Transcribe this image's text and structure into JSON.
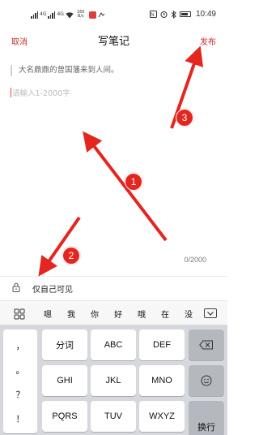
{
  "status_bar": {
    "net_label_1": "4G",
    "net_label_2": "4G",
    "speed_top": "160",
    "speed_bottom": "B/s",
    "time": "10:49"
  },
  "header": {
    "cancel_label": "取消",
    "title": "写笔记",
    "publish_label": "发布"
  },
  "editor": {
    "quote_text": "大名鼎鼎的曾国藩来到人间。",
    "placeholder": "请输入1-2000字",
    "char_count": "0/2000"
  },
  "privacy": {
    "label": "仅自己可见"
  },
  "candidates": [
    "嗯",
    "我",
    "你",
    "好",
    "哦",
    "在",
    "没"
  ],
  "keyboard": {
    "punct": [
      "，",
      "。",
      "？",
      "！"
    ],
    "row1": [
      "分词",
      "ABC",
      "DEF"
    ],
    "row2": [
      "GHI",
      "JKL",
      "MNO"
    ],
    "row3": [
      "PQRS",
      "TUV",
      "WXYZ"
    ],
    "enter_label": "换行",
    "colors": {
      "bg": "#d6d8dd",
      "key": "#ffffff",
      "dark_key": "#b5b8bf"
    }
  },
  "annotations": {
    "badges": [
      "1",
      "2",
      "3"
    ],
    "color": "#e3261f"
  },
  "icons": [
    "lock-icon",
    "grid-icon",
    "keyboard-hide-icon",
    "backspace-icon",
    "emoji-icon",
    "wifi-icon",
    "alarm-icon",
    "bluetooth-icon",
    "battery-icon"
  ],
  "accent_color": "#c2302c"
}
